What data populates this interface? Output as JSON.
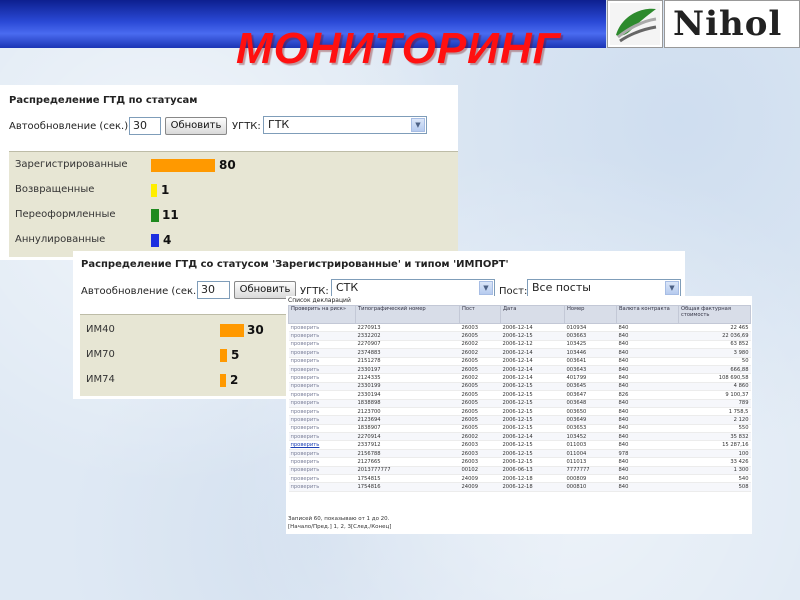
{
  "header": {
    "title": "МОНИТОРИНГ",
    "logo_text": "Nihol"
  },
  "colors": {
    "header_blue": "#2a49d6",
    "title_red": "#ff1010",
    "bar_orange": "#ff9900",
    "bar_yellow": "#ffee00",
    "bar_green": "#1f8a1f",
    "bar_blue": "#1c2fe0",
    "stat_bg": "#e7e6d4"
  },
  "panel1": {
    "title": "Распределение ГТД по статусам",
    "autorefresh_label": "Автообновление (сек.):",
    "autorefresh_value": "30",
    "refresh_button": "Обновить",
    "ugtk_label": "УГТК:",
    "ugtk_value": "ГТК",
    "stats": [
      {
        "label": "Зарегистрированные",
        "value": "80",
        "color": "orange"
      },
      {
        "label": "Возвращенные",
        "value": "1",
        "color": "yellow"
      },
      {
        "label": "Переоформленные",
        "value": "11",
        "color": "green"
      },
      {
        "label": "Аннулированные",
        "value": "4",
        "color": "blue"
      }
    ]
  },
  "panel2": {
    "title": "Распределение ГТД со статусом 'Зарегистрированные' и типом 'ИМПОРТ'",
    "autorefresh_label": "Автообновление (сек.):",
    "autorefresh_value": "30",
    "refresh_button": "Обновить",
    "ugtk_label": "УГТК:",
    "ugtk_value": "СТК",
    "post_label": "Пост:",
    "post_value": "Все посты",
    "stats": [
      {
        "label": "ИМ40",
        "value": "30"
      },
      {
        "label": "ИМ70",
        "value": "5"
      },
      {
        "label": "ИМ74",
        "value": "2"
      }
    ]
  },
  "declarations": {
    "caption": "Список деклараций",
    "columns": [
      "Проверить на риск»",
      "Типографический номер",
      "Пост",
      "Дата",
      "Номер",
      "Валюта контракта",
      "Общая фактурная стоимость"
    ],
    "rows": [
      [
        "проверить",
        "2270913",
        "26003",
        "2006-12-14",
        "010934",
        "840",
        "22 465"
      ],
      [
        "проверить",
        "2332202",
        "26005",
        "2006-12-15",
        "003663",
        "840",
        "22 036,69"
      ],
      [
        "проверить",
        "2270907",
        "26002",
        "2006-12-12",
        "103425",
        "840",
        "63 852"
      ],
      [
        "проверить",
        "2374883",
        "26002",
        "2006-12-14",
        "103446",
        "840",
        "3 980"
      ],
      [
        "проверить",
        "2151278",
        "26005",
        "2006-12-14",
        "003641",
        "840",
        "50"
      ],
      [
        "проверить",
        "2330197",
        "26005",
        "2006-12-14",
        "003643",
        "840",
        "666,88"
      ],
      [
        "проверить",
        "2124335",
        "26002",
        "2006-12-14",
        "401799",
        "840",
        "108 690,58"
      ],
      [
        "проверить",
        "2330199",
        "26005",
        "2006-12-15",
        "003645",
        "840",
        "4 860"
      ],
      [
        "проверить",
        "2330194",
        "26005",
        "2006-12-15",
        "003647",
        "826",
        "9 100,37"
      ],
      [
        "проверить",
        "1838898",
        "26005",
        "2006-12-15",
        "003648",
        "840",
        "789"
      ],
      [
        "проверить",
        "2123700",
        "26005",
        "2006-12-15",
        "003650",
        "840",
        "1 758,5"
      ],
      [
        "проверить",
        "2123694",
        "26005",
        "2006-12-15",
        "003649",
        "840",
        "2 120"
      ],
      [
        "проверить",
        "1838907",
        "26005",
        "2006-12-15",
        "003653",
        "840",
        "550"
      ],
      [
        "проверить",
        "2270914",
        "26002",
        "2006-12-14",
        "103452",
        "840",
        "35 832"
      ],
      [
        "проверить",
        "2337912",
        "26003",
        "2006-12-15",
        "011003",
        "840",
        "15 287,16"
      ],
      [
        "проверить",
        "2156788",
        "26003",
        "2006-12-15",
        "011004",
        "978",
        "100"
      ],
      [
        "проверить",
        "2127665",
        "26003",
        "2006-12-15",
        "011013",
        "840",
        "33 426"
      ],
      [
        "проверить",
        "2013777777",
        "00102",
        "2006-06-13",
        "7777777",
        "840",
        "1 300"
      ],
      [
        "проверить",
        "1754815",
        "24009",
        "2006-12-18",
        "000809",
        "840",
        "540"
      ],
      [
        "проверить",
        "1754816",
        "24009",
        "2006-12-18",
        "000810",
        "840",
        "508"
      ]
    ],
    "footer_count": "Записей 60, показываю от 1 до 20.",
    "footer_pager": "[Начало/Пред.] 1, 2, 3[След./Конец]"
  }
}
